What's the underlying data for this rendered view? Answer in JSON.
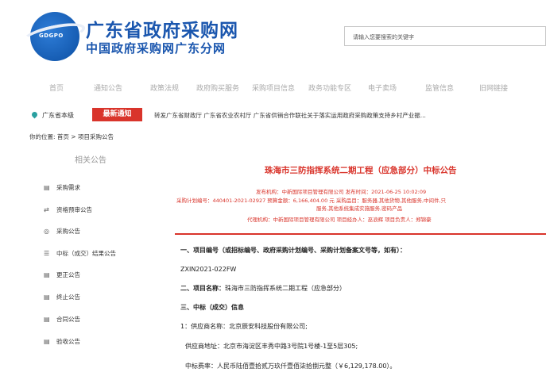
{
  "header": {
    "logo_text": "GDGPO",
    "title": "广东省政府采购网",
    "subtitle": "中国政府采购网广东分网",
    "search_placeholder": "请输入您要搜索的关键字"
  },
  "nav": {
    "items": [
      "首页",
      "通知公告",
      "政策法规",
      "政府购买服务",
      "采购项目信息",
      "政务功能专区",
      "电子卖场",
      "监管信息",
      "旧网链接"
    ]
  },
  "notice": {
    "location": "广东省本级",
    "badge": "最新通知",
    "text": "转发广东省财政厅 广东省农业农村厅 广东省供销合作联社关于落实运用政府采购政策支持乡村产业振..."
  },
  "breadcrumb": "你的位置: 首页 > 项目采购公告",
  "sidebar": {
    "title": "相关公告",
    "items": [
      {
        "label": "采购需求",
        "icon": "document-icon"
      },
      {
        "label": "资格预审公告",
        "icon": "arrows-icon"
      },
      {
        "label": "采购公告",
        "icon": "target-icon"
      },
      {
        "label": "中标（成交）结果公告",
        "icon": "list-icon"
      },
      {
        "label": "更正公告",
        "icon": "document-icon"
      },
      {
        "label": "终止公告",
        "icon": "document-icon"
      },
      {
        "label": "合同公告",
        "icon": "document-icon"
      },
      {
        "label": "验收公告",
        "icon": "document-icon"
      }
    ]
  },
  "main": {
    "title": "珠海市三防指挥系统二期工程（应急部分）中标公告",
    "meta_row1": "发布机构：中新国际项目管理有限公司      发布时间：2021-06-25 10:02:09",
    "meta_row2": "采购计划编号：440401-2021-02927      预算金额：6,166,404.00 元      采购品目：服务器,其他货物,其他服务,中间件,只",
    "meta_row3": "服务,其他系统集成实施服务,密码产品",
    "meta_row4": "代理机构：中新国际项目管理有限公司      项目经办人：巫浪辉      项目负责人：郑锦豪",
    "line1": "一、项目编号（或招标编号、政府采购计划编号、采购计划备案文号等，如有）：",
    "line2": "ZXIN2021-022FW",
    "line3_prefix": "二、项目名称：",
    "line3_value": "珠海市三防指挥系统二期工程（应急部分）",
    "line4": "三、中标（成交）信息",
    "line5": "1：供应商名称：北京辰安科技股份有限公司;",
    "line6": "供应商地址：北京市海淀区丰秀中路3号院1号楼-1至5层305;",
    "line7": "中标费率：人民币陆佰壹拾贰万玖仟壹佰柒拾捌元整（￥6,129,178.00）。"
  },
  "colors": {
    "brand_blue": "#1a56ae",
    "accent_red": "#d9342b"
  }
}
